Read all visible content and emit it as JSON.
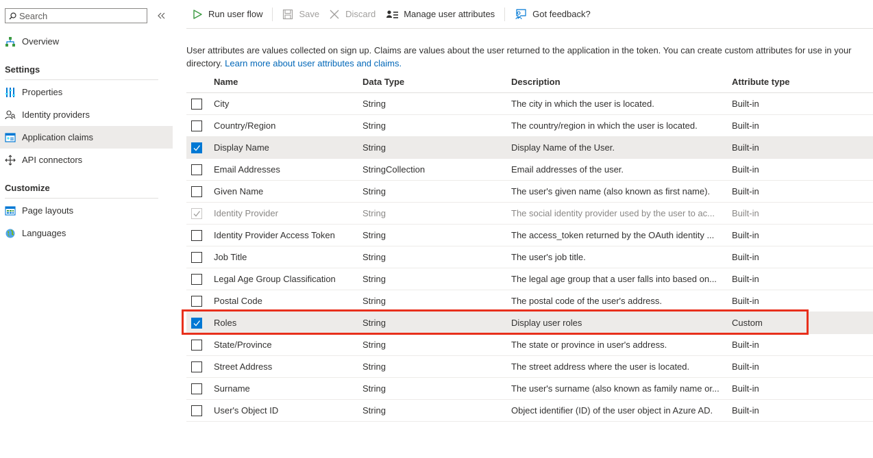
{
  "sidebar": {
    "search_placeholder": "Search",
    "items": [
      {
        "label": "Overview",
        "icon": "overview-icon"
      },
      {
        "label": "Properties",
        "icon": "properties-icon"
      },
      {
        "label": "Identity providers",
        "icon": "identity-providers-icon"
      },
      {
        "label": "Application claims",
        "icon": "application-claims-icon"
      },
      {
        "label": "API connectors",
        "icon": "api-connectors-icon"
      },
      {
        "label": "Page layouts",
        "icon": "page-layouts-icon"
      },
      {
        "label": "Languages",
        "icon": "languages-icon"
      }
    ],
    "sections": [
      "Settings",
      "Customize"
    ]
  },
  "toolbar": {
    "run_user_flow": "Run user flow",
    "save": "Save",
    "discard": "Discard",
    "manage_user_attributes": "Manage user attributes",
    "got_feedback": "Got feedback?"
  },
  "description": {
    "text": "User attributes are values collected on sign up. Claims are values about the user returned to the application in the token. You can create custom attributes for use in your directory.",
    "link": "Learn more about user attributes and claims."
  },
  "table": {
    "headers": [
      "Name",
      "Data Type",
      "Description",
      "Attribute type"
    ],
    "rows": [
      {
        "name": "City",
        "type": "String",
        "desc": "The city in which the user is located.",
        "attr": "Built-in",
        "checked": false
      },
      {
        "name": "Country/Region",
        "type": "String",
        "desc": "The country/region in which the user is located.",
        "attr": "Built-in",
        "checked": false
      },
      {
        "name": "Display Name",
        "type": "String",
        "desc": "Display Name of the User.",
        "attr": "Built-in",
        "checked": true
      },
      {
        "name": "Email Addresses",
        "type": "StringCollection",
        "desc": "Email addresses of the user.",
        "attr": "Built-in",
        "checked": false
      },
      {
        "name": "Given Name",
        "type": "String",
        "desc": "The user's given name (also known as first name).",
        "attr": "Built-in",
        "checked": false
      },
      {
        "name": "Identity Provider",
        "type": "String",
        "desc": "The social identity provider used by the user to ac...",
        "attr": "Built-in",
        "checked": true,
        "disabled": true
      },
      {
        "name": "Identity Provider Access Token",
        "type": "String",
        "desc": "The access_token returned by the OAuth identity ...",
        "attr": "Built-in",
        "checked": false
      },
      {
        "name": "Job Title",
        "type": "String",
        "desc": "The user's job title.",
        "attr": "Built-in",
        "checked": false
      },
      {
        "name": "Legal Age Group Classification",
        "type": "String",
        "desc": "The legal age group that a user falls into based on...",
        "attr": "Built-in",
        "checked": false
      },
      {
        "name": "Postal Code",
        "type": "String",
        "desc": "The postal code of the user's address.",
        "attr": "Built-in",
        "checked": false
      },
      {
        "name": "Roles",
        "type": "String",
        "desc": "Display user roles",
        "attr": "Custom",
        "checked": true
      },
      {
        "name": "State/Province",
        "type": "String",
        "desc": "The state or province in user's address.",
        "attr": "Built-in",
        "checked": false
      },
      {
        "name": "Street Address",
        "type": "String",
        "desc": "The street address where the user is located.",
        "attr": "Built-in",
        "checked": false
      },
      {
        "name": "Surname",
        "type": "String",
        "desc": "The user's surname (also known as family name or...",
        "attr": "Built-in",
        "checked": false
      },
      {
        "name": "User's Object ID",
        "type": "String",
        "desc": "Object identifier (ID) of the user object in Azure AD.",
        "attr": "Built-in",
        "checked": false
      }
    ]
  },
  "colors": {
    "accent": "#0078d4",
    "highlight": "#e8301c",
    "selected_row": "#edebe9"
  }
}
